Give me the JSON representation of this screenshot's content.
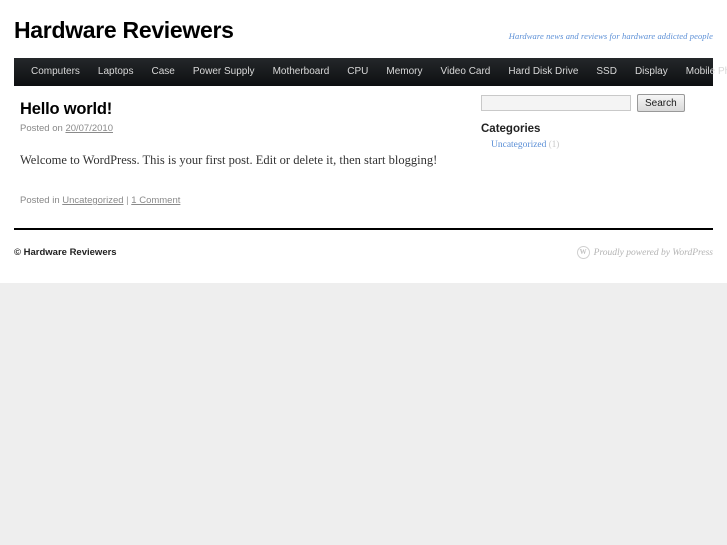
{
  "site": {
    "title": "Hardware Reviewers",
    "description": "Hardware news and reviews for hardware addicted people"
  },
  "nav": {
    "items": [
      {
        "label": "Computers"
      },
      {
        "label": "Laptops"
      },
      {
        "label": "Case"
      },
      {
        "label": "Power Supply"
      },
      {
        "label": "Motherboard"
      },
      {
        "label": "CPU"
      },
      {
        "label": "Memory"
      },
      {
        "label": "Video Card"
      },
      {
        "label": "Hard Disk Drive"
      },
      {
        "label": "SSD"
      },
      {
        "label": "Display"
      },
      {
        "label": "Mobile Phones"
      }
    ]
  },
  "post": {
    "title": "Hello world!",
    "posted_on_prefix": "Posted on",
    "date": "20/07/2010",
    "content": "Welcome to WordPress. This is your first post. Edit or delete it, then start blogging!",
    "posted_in_prefix": "Posted in",
    "category": "Uncategorized",
    "separator": "|",
    "comments": "1 Comment"
  },
  "sidebar": {
    "search": {
      "value": "",
      "placeholder": "",
      "button_label": "Search"
    },
    "categories": {
      "title": "Categories",
      "items": [
        {
          "label": "Uncategorized",
          "count": "(1)"
        }
      ]
    }
  },
  "footer": {
    "copyright": "© Hardware Reviewers",
    "generator": "Proudly powered by WordPress",
    "wp_logo_glyph": "W"
  },
  "colors": {
    "nav_background": "#14171a",
    "link_blue": "#5b8fd6",
    "page_background": "#eeeeee",
    "content_background": "#ffffff"
  }
}
